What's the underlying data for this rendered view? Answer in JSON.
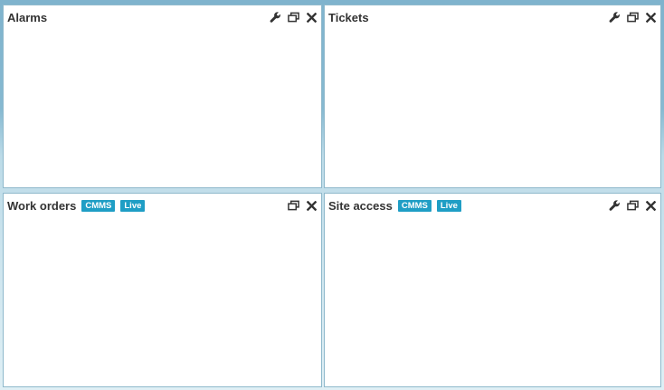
{
  "colors": {
    "badge_bg": "#1f9ec5",
    "panel_bg": "#ffffff",
    "title_text": "#333333",
    "background": "#86b9d1"
  },
  "panels": [
    {
      "title": "Alarms",
      "badges": [],
      "icons": [
        "wrench-icon",
        "popout-icon",
        "close-icon"
      ]
    },
    {
      "title": "Tickets",
      "badges": [],
      "icons": [
        "wrench-icon",
        "popout-icon",
        "close-icon"
      ]
    },
    {
      "title": "Work orders",
      "badges": [
        "CMMS",
        "Live"
      ],
      "icons": [
        "popout-icon",
        "close-icon"
      ]
    },
    {
      "title": "Site access",
      "badges": [
        "CMMS",
        "Live"
      ],
      "icons": [
        "wrench-icon",
        "popout-icon",
        "close-icon"
      ]
    }
  ]
}
